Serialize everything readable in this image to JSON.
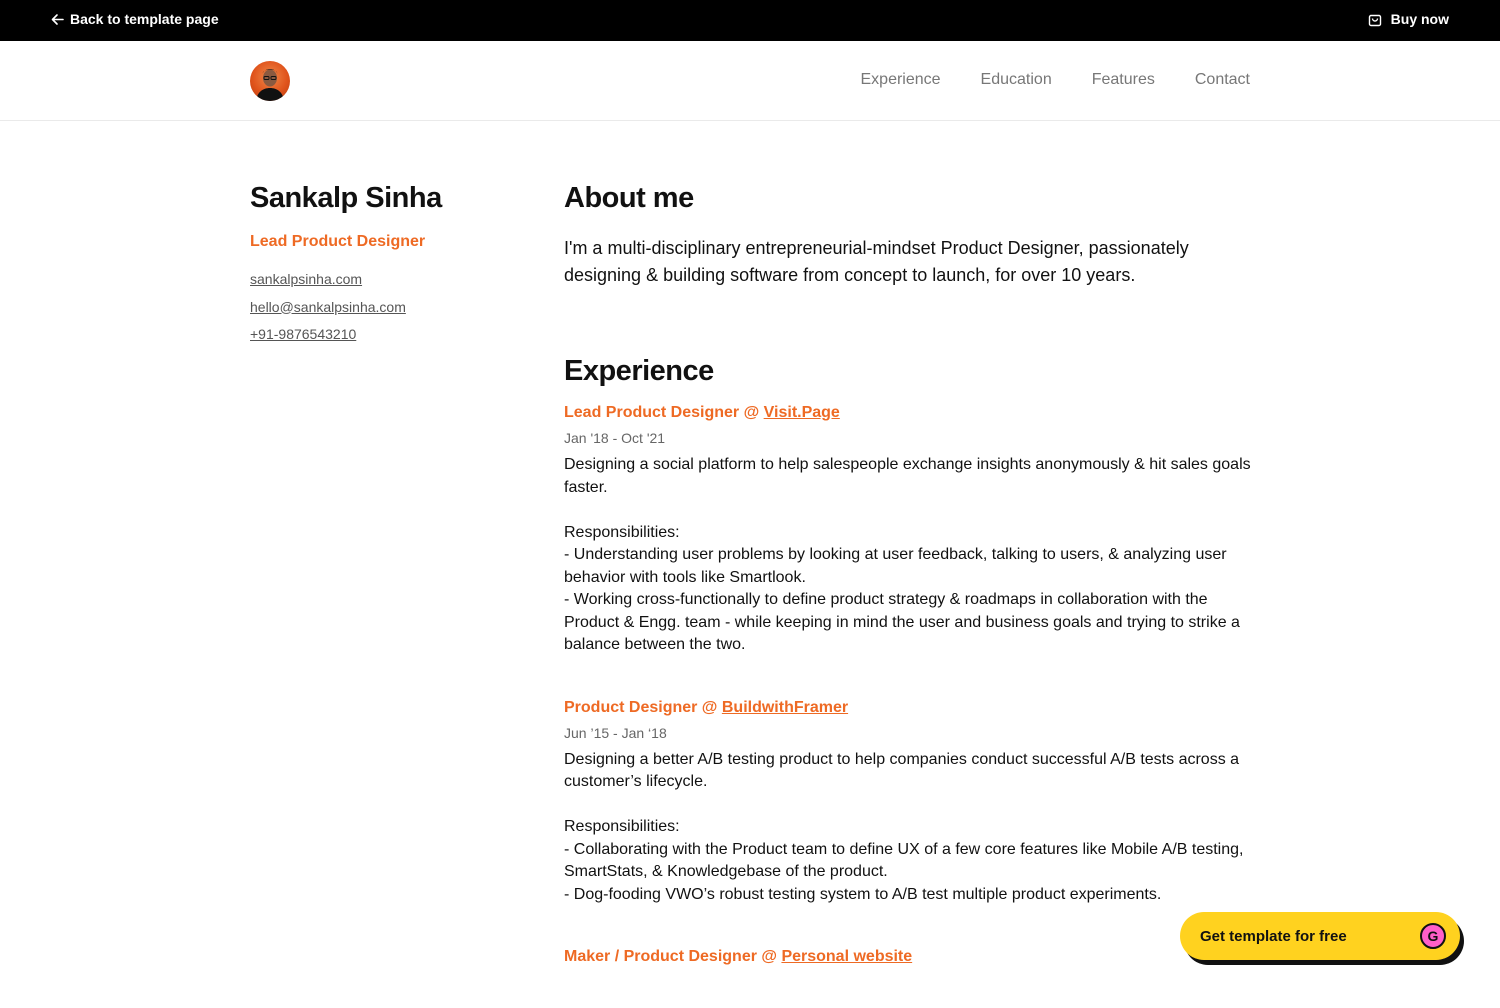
{
  "topbar": {
    "back_label": "Back to template page",
    "buy_label": "Buy now",
    "back_icon": "arrow-left-icon",
    "buy_icon": "shopping-bag-icon"
  },
  "header": {
    "avatar_icon": "profile-avatar",
    "nav": [
      "Experience",
      "Education",
      "Features",
      "Contact"
    ]
  },
  "profile": {
    "name": "Sankalp Sinha",
    "role": "Lead Product Designer",
    "website": "sankalpsinha.com",
    "email": "hello@sankalpsinha.com",
    "phone": "+91-9876543210"
  },
  "about": {
    "heading": "About me",
    "text": "I'm a multi-disciplinary entrepreneurial-mindset Product Designer, passionately designing & building software from concept to launch, for over 10 years."
  },
  "experience": {
    "heading": "Experience",
    "jobs": [
      {
        "title_prefix": "Lead Product Designer @ ",
        "company": "Visit.Page",
        "dates": "Jan '18 - Oct '21",
        "description": "Designing a social platform to help salespeople exchange insights anonymously & hit sales goals faster.\n\nResponsibilities:\n- Understanding user problems by looking at user feedback, talking to users, & analyzing user behavior with tools like Smartlook.\n- Working cross-functionally to define product strategy & roadmaps in collaboration with the Product & Engg. team - while keeping in mind the user and business goals and trying to strike a balance between the two."
      },
      {
        "title_prefix": "Product Designer @ ",
        "company": "BuildwithFramer",
        "dates": "Jun ’15 - Jan ‘18",
        "description": "Designing a better A/B testing product to help companies conduct successful A/B tests across a customer’s lifecycle.\n\nResponsibilities:\n- Collaborating with the Product team to define UX of a few core features like Mobile A/B testing, SmartStats, & Knowledgebase of the product.\n- Dog-fooding VWO’s robust testing system to A/B test multiple product experiments."
      },
      {
        "title_prefix": "Maker / Product Designer @ ",
        "company": "Personal website",
        "dates": "",
        "description": ""
      }
    ]
  },
  "cta": {
    "label": "Get template for free",
    "icon_letter": "G",
    "accent": "#ffd21f"
  },
  "colors": {
    "accent": "#ee6a24",
    "topbar": "#000000",
    "cta_icon": "#ff5fc8"
  }
}
